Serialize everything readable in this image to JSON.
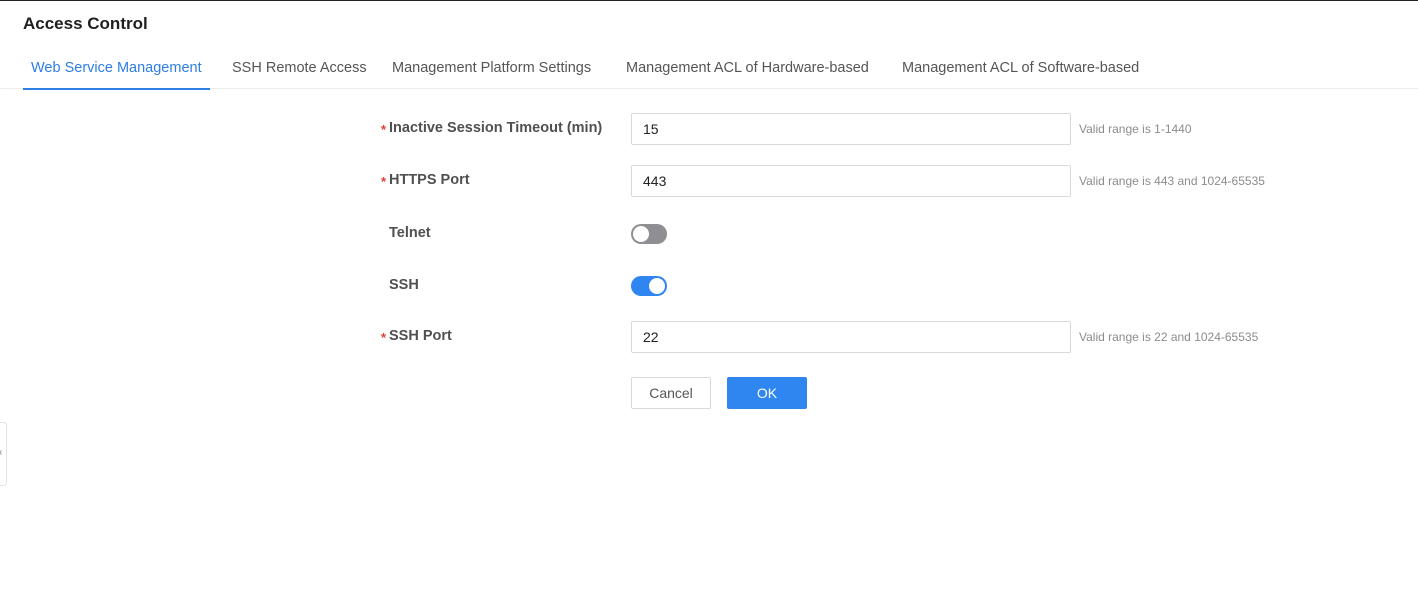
{
  "page": {
    "title": "Access Control"
  },
  "tabs": [
    {
      "label": "Web Service Management",
      "active": true
    },
    {
      "label": "SSH Remote Access",
      "active": false
    },
    {
      "label": "Management Platform Settings",
      "active": false
    },
    {
      "label": "Management ACL of Hardware-based",
      "active": false
    },
    {
      "label": "Management ACL of Software-based",
      "active": false
    }
  ],
  "form": {
    "required_mark": "*",
    "timeout": {
      "label": "Inactive Session Timeout (min)",
      "value": "15",
      "hint": "Valid range is 1-1440"
    },
    "https_port": {
      "label": "HTTPS Port",
      "value": "443",
      "hint": "Valid range is 443 and 1024-65535"
    },
    "telnet": {
      "label": "Telnet",
      "enabled": false
    },
    "ssh": {
      "label": "SSH",
      "enabled": true
    },
    "ssh_port": {
      "label": "SSH Port",
      "value": "22",
      "hint": "Valid range is 22 and 1024-65535"
    }
  },
  "buttons": {
    "cancel": "Cancel",
    "ok": "OK"
  },
  "side_handle": {
    "icon": "chevron-left-icon",
    "glyph": "‹"
  },
  "colors": {
    "accent": "#2f86f0",
    "tab_active": "#2f7ee5",
    "required": "#e53935",
    "switch_off": "#8e8e93"
  }
}
